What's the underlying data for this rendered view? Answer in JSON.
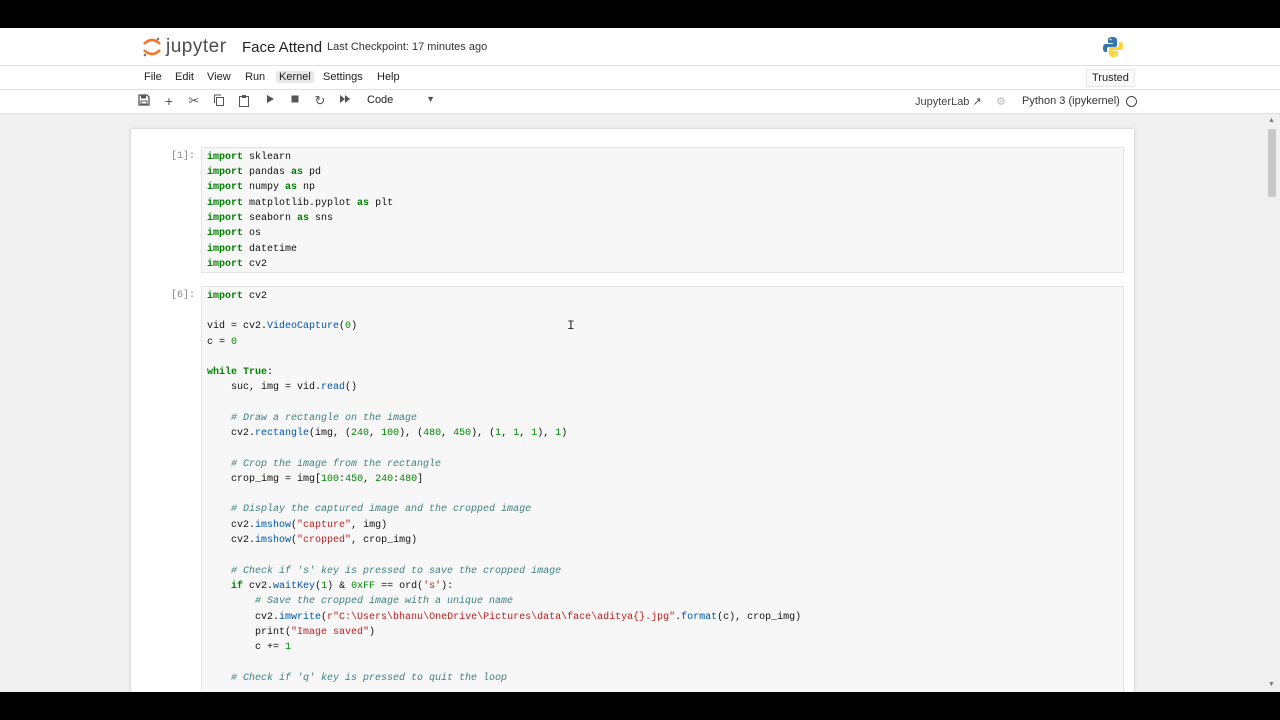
{
  "header": {
    "logo_text": "jupyter",
    "notebook_title": "Face Attend",
    "checkpoint": "Last Checkpoint: 17 minutes ago"
  },
  "menu": {
    "items": [
      "File",
      "Edit",
      "View",
      "Run",
      "Kernel",
      "Settings",
      "Help"
    ],
    "active": "Kernel",
    "trusted": "Trusted"
  },
  "toolbar": {
    "cell_type": "Code",
    "jupyterlab": "JupyterLab",
    "kernel": "Python 3 (ipykernel)"
  },
  "cells": [
    {
      "prompt": "[1]:",
      "lines": [
        "import sklearn",
        "import pandas as pd",
        "import numpy as np",
        "import matplotlib.pyplot as plt",
        "import seaborn as sns",
        "import os",
        "import datetime",
        "import cv2"
      ]
    },
    {
      "prompt": "[6]:",
      "lines": [
        "import cv2",
        "",
        "vid = cv2.VideoCapture(0)",
        "c = 0",
        "",
        "while True:",
        "    suc, img = vid.read()",
        "",
        "    # Draw a rectangle on the image",
        "    cv2.rectangle(img, (240, 100), (480, 450), (1, 1, 1), 1)",
        "",
        "    # Crop the image from the rectangle",
        "    crop_img = img[100:450, 240:480]",
        "",
        "    # Display the captured image and the cropped image",
        "    cv2.imshow(\"capture\", img)",
        "    cv2.imshow(\"cropped\", crop_img)",
        "",
        "    # Check if 's' key is pressed to save the cropped image",
        "    if cv2.waitKey(1) & 0xFF == ord('s'):",
        "        # Save the cropped image with a unique name",
        "        cv2.imwrite(r\"C:\\Users\\bhanu\\OneDrive\\Pictures\\data\\face\\aditya{}.jpg\".format(c), crop_img)",
        "        print(\"Image saved\")",
        "        c += 1",
        "",
        "    # Check if 'q' key is pressed to quit the loop"
      ]
    }
  ],
  "colors": {
    "keyword": "#008000",
    "string": "#ba2121",
    "comment": "#408080",
    "number": "#008800"
  }
}
